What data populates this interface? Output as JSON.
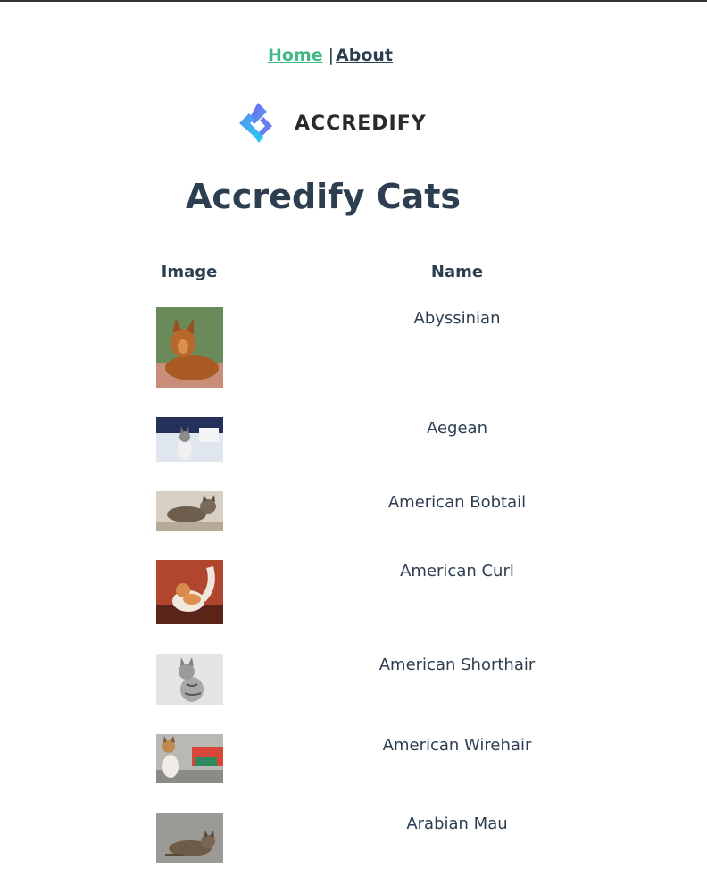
{
  "nav": {
    "home_label": "Home",
    "separator": "|",
    "about_label": "About"
  },
  "logo": {
    "text": "ACCREDIFY"
  },
  "page": {
    "title": "Accredify Cats"
  },
  "table": {
    "headers": {
      "image": "Image",
      "name": "Name"
    },
    "rows": [
      {
        "name": "Abyssinian"
      },
      {
        "name": "Aegean"
      },
      {
        "name": "American Bobtail"
      },
      {
        "name": "American Curl"
      },
      {
        "name": "American Shorthair"
      },
      {
        "name": "American Wirehair"
      },
      {
        "name": "Arabian Mau"
      }
    ]
  },
  "colors": {
    "link_active": "#42b983",
    "text": "#2c3e50"
  }
}
